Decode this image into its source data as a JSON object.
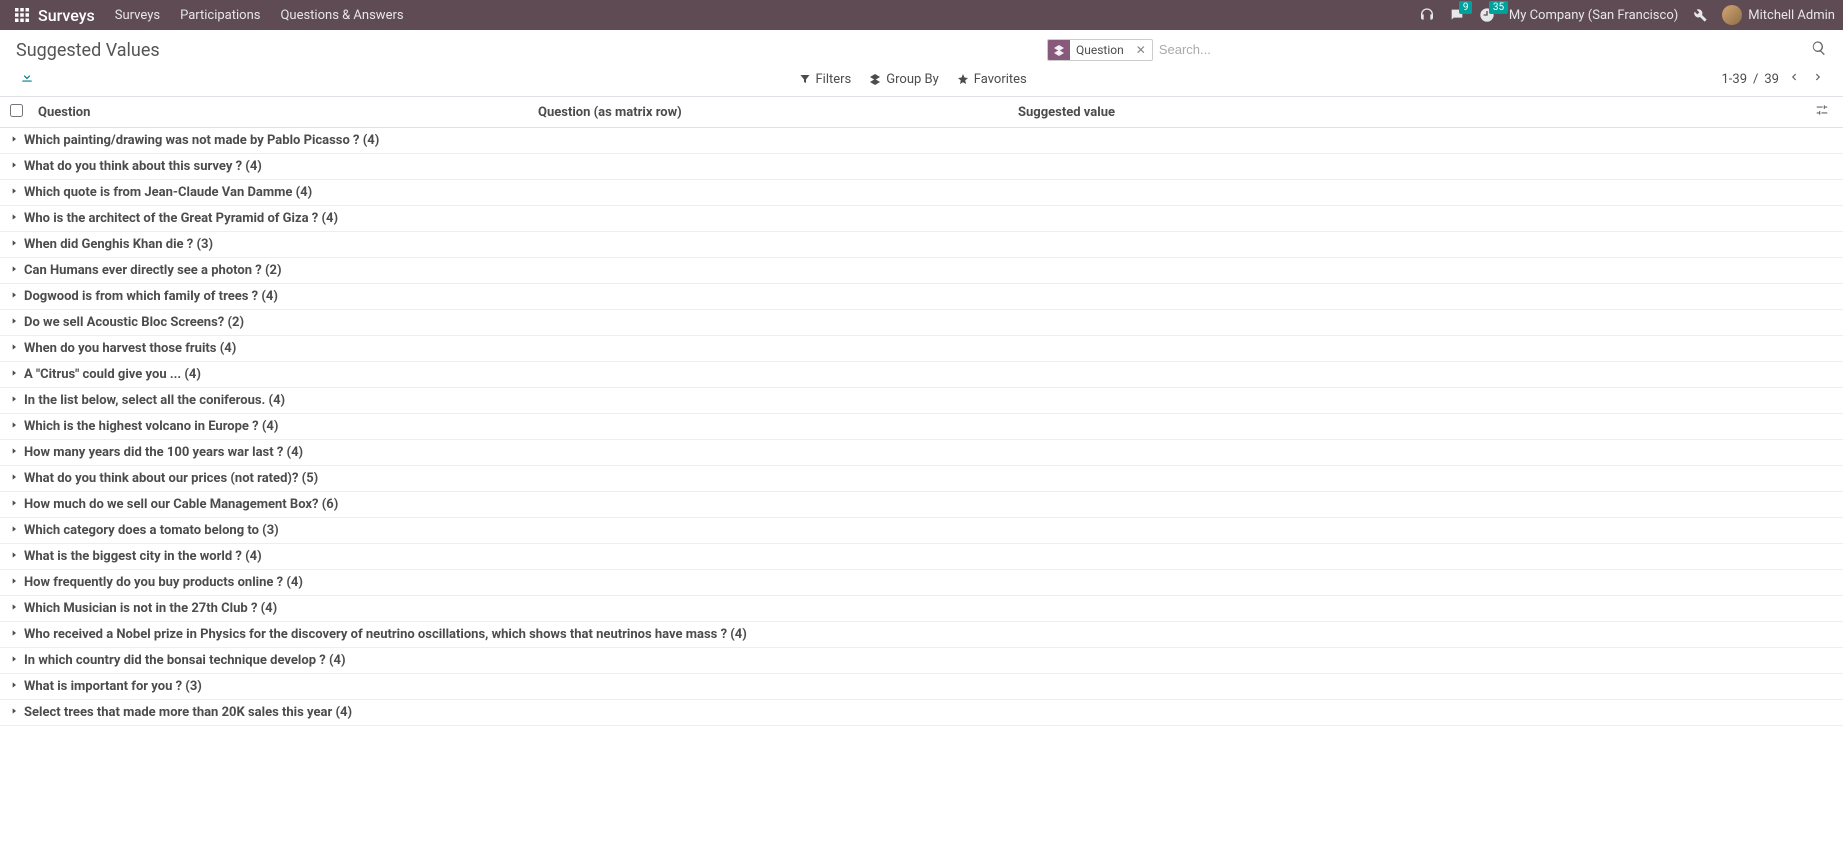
{
  "navbar": {
    "app_title": "Surveys",
    "menu": [
      "Surveys",
      "Participations",
      "Questions & Answers"
    ],
    "messages_badge": "9",
    "activities_badge": "35",
    "company": "My Company (San Francisco)",
    "user_name": "Mitchell Admin"
  },
  "page": {
    "title": "Suggested Values"
  },
  "search": {
    "facet_label": "Question",
    "placeholder": "Search..."
  },
  "toolbar": {
    "filters": "Filters",
    "group_by": "Group By",
    "favorites": "Favorites"
  },
  "pager": {
    "range": "1-39",
    "total": "39"
  },
  "columns": {
    "question": "Question",
    "matrix": "Question (as matrix row)",
    "suggested_value": "Suggested value"
  },
  "groups": [
    {
      "label": "Which painting/drawing was not made by Pablo Picasso ? (4)"
    },
    {
      "label": "What do you think about this survey ? (4)"
    },
    {
      "label": "Which quote is from Jean-Claude Van Damme (4)"
    },
    {
      "label": "Who is the architect of the Great Pyramid of Giza ? (4)"
    },
    {
      "label": "When did Genghis Khan die ? (3)"
    },
    {
      "label": "Can Humans ever directly see a photon ? (2)"
    },
    {
      "label": "Dogwood is from which family of trees ? (4)"
    },
    {
      "label": "Do we sell Acoustic Bloc Screens? (2)"
    },
    {
      "label": "When do you harvest those fruits (4)"
    },
    {
      "label": "A \"Citrus\" could give you ... (4)"
    },
    {
      "label": "In the list below, select all the coniferous. (4)"
    },
    {
      "label": "Which is the highest volcano in Europe ? (4)"
    },
    {
      "label": "How many years did the 100 years war last ? (4)"
    },
    {
      "label": "What do you think about our prices (not rated)? (5)"
    },
    {
      "label": "How much do we sell our Cable Management Box? (6)"
    },
    {
      "label": "Which category does a tomato belong to (3)"
    },
    {
      "label": "What is the biggest city in the world ? (4)"
    },
    {
      "label": "How frequently do you buy products online ? (4)"
    },
    {
      "label": "Which Musician is not in the 27th Club ? (4)"
    },
    {
      "label": "Who received a Nobel prize in Physics for the discovery of neutrino oscillations, which shows that neutrinos have mass ? (4)"
    },
    {
      "label": "In which country did the bonsai technique develop ? (4)"
    },
    {
      "label": "What is important for you ? (3)"
    },
    {
      "label": "Select trees that made more than 20K sales this year (4)"
    }
  ]
}
